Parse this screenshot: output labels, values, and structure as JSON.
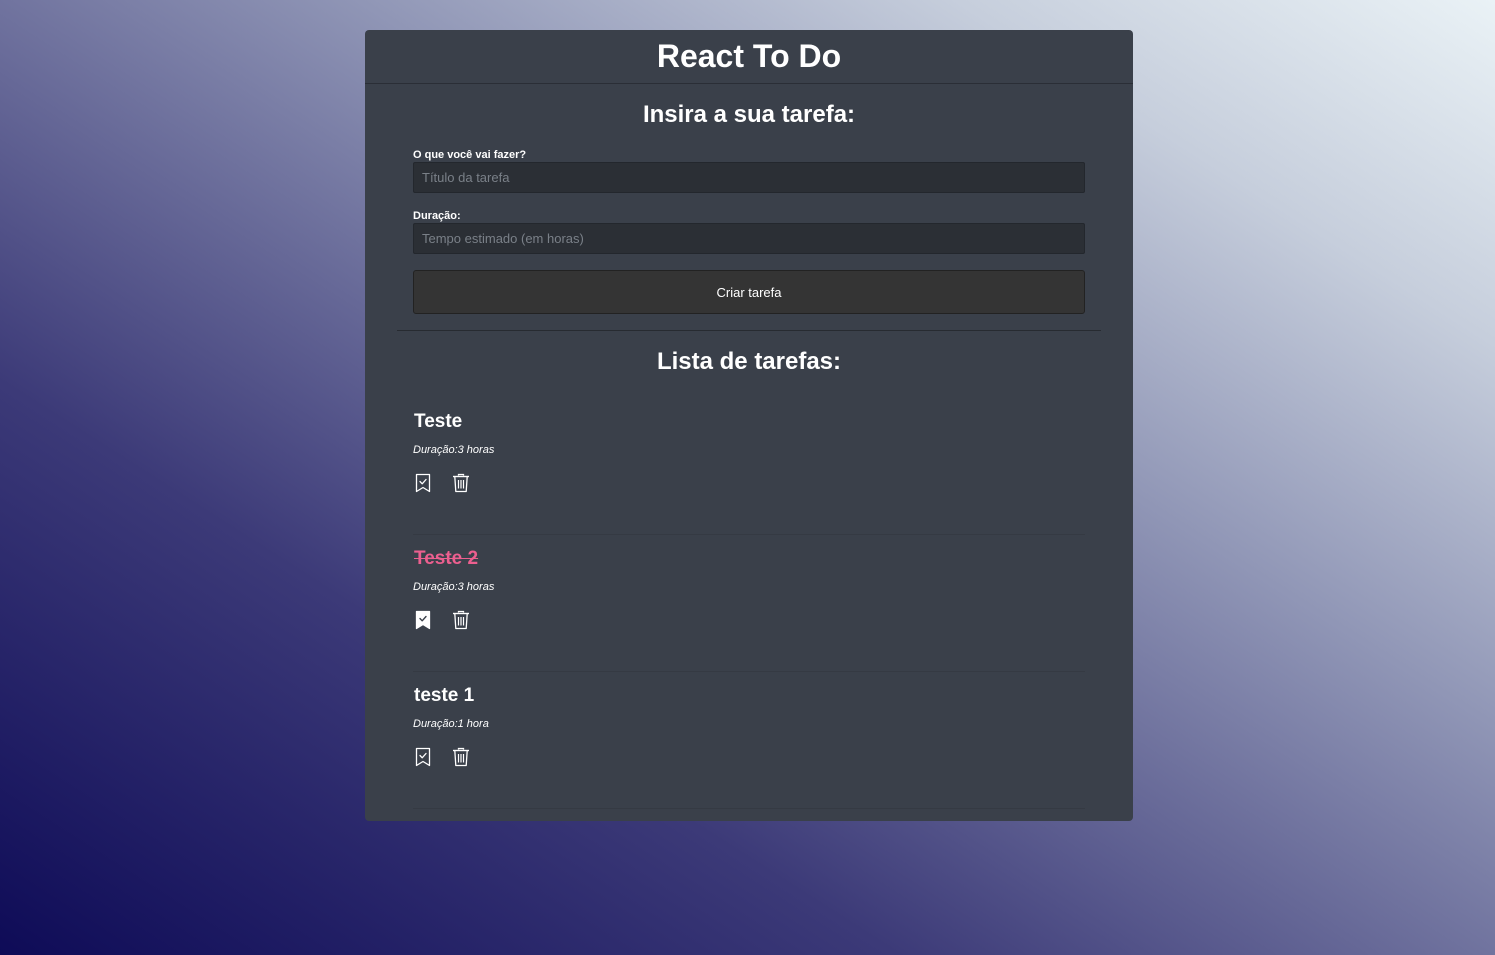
{
  "header": {
    "title": "React To Do"
  },
  "form": {
    "title": "Insira a sua tarefa:",
    "task_label": "O que você vai fazer?",
    "task_placeholder": "Título da tarefa",
    "task_value": "",
    "duration_label": "Duração:",
    "duration_placeholder": "Tempo estimado (em horas)",
    "duration_value": "",
    "submit_label": "Criar tarefa"
  },
  "list": {
    "title": "Lista de tarefas:",
    "tasks": [
      {
        "name": "Teste",
        "duration": "Duração:3 horas",
        "done": false
      },
      {
        "name": "Teste 2",
        "duration": "Duração:3 horas",
        "done": true
      },
      {
        "name": "teste 1",
        "duration": "Duração:1 hora",
        "done": false
      }
    ]
  },
  "colors": {
    "card": "#3a404a",
    "done_text": "#ec5f8f",
    "input_bg": "#2b2f35",
    "button_bg": "#343434"
  },
  "icons": {
    "complete": "bookmark-check-icon",
    "delete": "trash-icon"
  }
}
